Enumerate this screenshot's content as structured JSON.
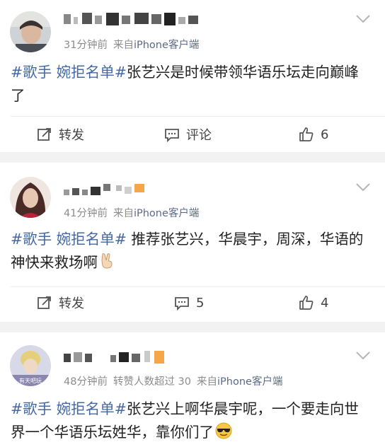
{
  "posts": [
    {
      "time": "31分钟前",
      "extra": "",
      "source_prefix": "来自",
      "client": "iPhone客户端",
      "tags": [
        "#歌手",
        "婉拒名单#"
      ],
      "text": "张艺兴是时候带领华语乐坛走向巅峰了",
      "actions": {
        "repost": "转发",
        "comment": "评论",
        "like": "6"
      }
    },
    {
      "time": "41分钟前",
      "extra": "",
      "source_prefix": "来自",
      "client": "iPhone客户端",
      "tags": [
        "#歌手",
        "婉拒名单#"
      ],
      "text": " 推荐张艺兴，华晨宇，周深，华语的神快来救场啊",
      "emoji": "victory-hand-emoji",
      "actions": {
        "repost": "转发",
        "comment": "5",
        "like": "4"
      }
    },
    {
      "time": "48分钟前",
      "extra": "转赞人数超过 30",
      "source_prefix": "来自",
      "client": "iPhone客户端",
      "avatar_text": "有天吧玩",
      "tags": [
        "#歌手",
        "婉拒名单#"
      ],
      "text": "张艺兴上啊华晨宇呢，一个要走向世界一个华语乐坛姓华，靠你们了",
      "emoji": "sunglasses-emoji"
    }
  ],
  "colors": {
    "tag": "#4468a6",
    "meta": "#8c8c8c",
    "client": "#5b6a8a",
    "background": "#f2f2f2",
    "card": "#ffffff"
  }
}
